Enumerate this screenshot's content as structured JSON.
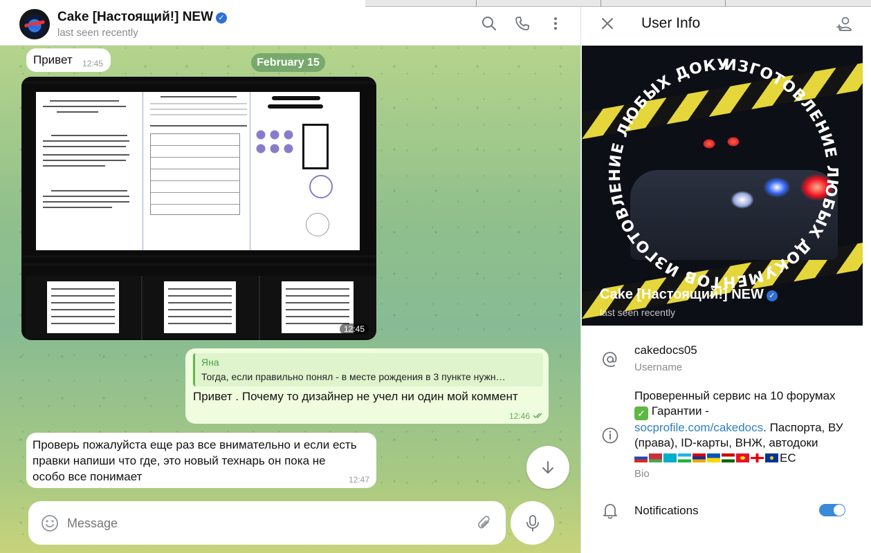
{
  "chat": {
    "title": "Cake [Настоящий!] NEW",
    "status": "last seen recently",
    "date_pill": "February 15",
    "messages": {
      "m1": {
        "text": "Привет",
        "time": "12:45"
      },
      "album_time": "12:45",
      "m2": {
        "reply_author": "Яна",
        "reply_text": "Тогда, если правильно понял - в месте рождения в 3 пункте нужн…",
        "text": "Привет . Почему то дизайнер не учел ни один мой коммент",
        "time": "12:46"
      },
      "m3": {
        "text": "Проверь пожалуйста еще раз все внимательно и если есть правки напиши что где, это новый технарь он пока не особо все понимает",
        "time": "12:47"
      }
    },
    "input": {
      "placeholder": "Message"
    }
  },
  "info": {
    "title": "User Info",
    "cover_name": "Cake [Настоящий!] NEW",
    "cover_status": "last seen recently",
    "cover_circle_text": "ИЗГОТОВЛЕНИЕ ЛЮБЫХ ДОКУМЕНТОВ",
    "username": "cakedocs05",
    "username_label": "Username",
    "bio_line1": "Проверенный сервис на 10 форумах",
    "bio_line2": "Гарантии -",
    "bio_link": "socprofile.com/cakedocs",
    "bio_rest": ". Паспорта, ВУ (права), ID-карты, ВНЖ, автодоки",
    "bio_suffix": "ЕС",
    "bio_label": "Bio",
    "notifications": "Notifications",
    "notifications_on": true
  },
  "colors": {
    "accent": "#2f7fc1",
    "verified": "#2f6fd6",
    "outgoing_bubble": "#effdde",
    "toggle_on": "#3a8ad8"
  },
  "icons": [
    "search-icon",
    "phone-icon",
    "more-vertical-icon",
    "close-icon",
    "add-contact-icon",
    "at-icon",
    "info-icon",
    "bell-icon",
    "emoji-icon",
    "attach-icon",
    "mic-icon",
    "arrow-down-icon",
    "verified-icon",
    "double-check-icon"
  ]
}
